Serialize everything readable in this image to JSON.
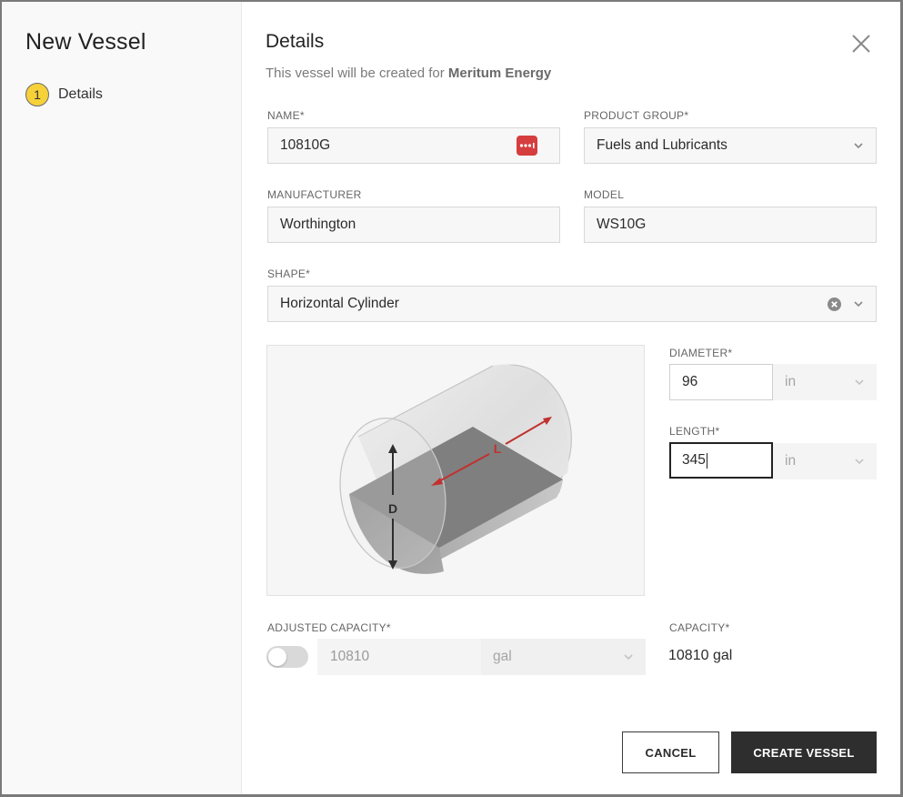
{
  "sidebar": {
    "title": "New Vessel",
    "steps": [
      {
        "number": "1",
        "label": "Details",
        "active": true,
        "badge_color": "#f6d13a"
      }
    ]
  },
  "header": {
    "title": "Details",
    "subtitle_prefix": "This vessel will be created for ",
    "company": "Meritum Energy",
    "close_icon": "close-icon"
  },
  "form": {
    "name": {
      "label": "NAME*",
      "value": "10810G",
      "icon": "password-manager-icon",
      "icon_color": "#d63d3f"
    },
    "product_group": {
      "label": "PRODUCT GROUP*",
      "value": "Fuels and Lubricants"
    },
    "manufacturer": {
      "label": "MANUFACTURER",
      "value": "Worthington"
    },
    "model": {
      "label": "MODEL",
      "value": "WS10G"
    },
    "shape": {
      "label": "SHAPE*",
      "value": "Horizontal Cylinder"
    },
    "diagram": {
      "diameter_label": "D",
      "length_label": "L",
      "accent_color": "#c0322f"
    },
    "diameter": {
      "label": "DIAMETER*",
      "value": "96",
      "unit": "in"
    },
    "length": {
      "label": "LENGTH*",
      "value": "345",
      "unit": "in"
    },
    "adjusted_capacity": {
      "label": "ADJUSTED CAPACITY*",
      "enabled": false,
      "value": "10810",
      "unit": "gal"
    },
    "capacity": {
      "label": "CAPACITY*",
      "value": "10810 gal"
    }
  },
  "actions": {
    "cancel_label": "CANCEL",
    "create_label": "CREATE VESSEL"
  }
}
